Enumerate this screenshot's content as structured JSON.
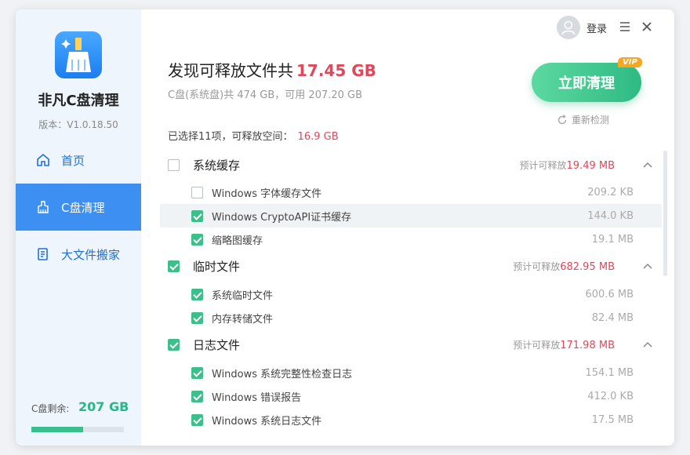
{
  "app": {
    "name": "非凡C盘清理",
    "version": "版本：V1.0.18.50"
  },
  "nav": [
    {
      "label": "首页",
      "icon": "home-icon",
      "active": false
    },
    {
      "label": "C盘清理",
      "icon": "broom-icon",
      "active": true
    },
    {
      "label": "大文件搬家",
      "icon": "document-icon",
      "active": false
    }
  ],
  "disk": {
    "label": "C盘剩余:",
    "value": "207 GB",
    "used_fraction": 0.56
  },
  "header": {
    "login_label": "登录",
    "found_prefix": "发现可释放文件共",
    "found_size": "17.45 GB",
    "disk_info": "C盘(系统盘)共 474 GB，可用 207.20 GB",
    "selected_prefix": "已选择11项，可释放空间：",
    "selected_size": "16.9 GB"
  },
  "actions": {
    "clean_label": "立即清理",
    "vip_badge": "VIP",
    "recheck_label": "重新检测"
  },
  "est_prefix": "预计可释放",
  "categories": [
    {
      "name": "系统缓存",
      "checked": false,
      "estimate": "19.49 MB",
      "items": [
        {
          "name": "Windows 字体缓存文件",
          "size": "209.2 KB",
          "checked": false
        },
        {
          "name": "Windows CryptoAPI证书缓存",
          "size": "144.0 KB",
          "checked": true
        },
        {
          "name": "缩略图缓存",
          "size": "19.1 MB",
          "checked": true
        }
      ]
    },
    {
      "name": "临时文件",
      "checked": true,
      "estimate": "682.95 MB",
      "items": [
        {
          "name": "系统临时文件",
          "size": "600.6 MB",
          "checked": true
        },
        {
          "name": "内存转储文件",
          "size": "82.4 MB",
          "checked": true
        }
      ]
    },
    {
      "name": "日志文件",
      "checked": true,
      "estimate": "171.98 MB",
      "items": [
        {
          "name": "Windows 系统完整性检查日志",
          "size": "154.1 MB",
          "checked": true
        },
        {
          "name": "Windows 错误报告",
          "size": "412.0 KB",
          "checked": true
        },
        {
          "name": "Windows 系统日志文件",
          "size": "17.5 MB",
          "checked": true
        }
      ]
    }
  ],
  "colors": {
    "accent": "#3d8ff2",
    "green": "#2fba83",
    "red": "#e0475b"
  }
}
